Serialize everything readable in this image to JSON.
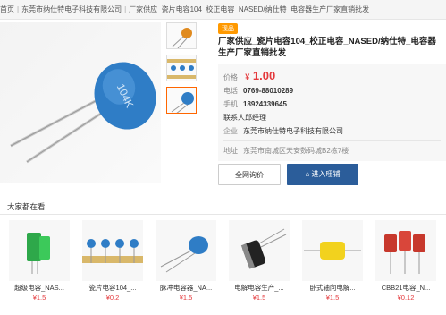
{
  "breadcrumb": {
    "home": "首页",
    "shop": "东莞市纳仕特电子科技有限公司",
    "product": "厂家供应_瓷片电容104_校正电容_NASED/纳仕特_电容器生产厂家直销批发"
  },
  "product": {
    "badge": "现品",
    "title": "厂家供应_瓷片电容104_校正电容_NASED/纳仕特_电容器生产厂家直销批发",
    "price_label": "价格",
    "price_currency": "¥",
    "price": "1.00",
    "phone_label": "电话",
    "phone": "0769-88010289",
    "mobile_label": "手机",
    "mobile": "18924339645",
    "contact_label": "联系人",
    "contact": "邱经理",
    "company_label": "企业",
    "company": "东莞市纳仕特电子科技有限公司",
    "address_label": "地址",
    "address": "东莞市南城区天安数码城B2栋7楼",
    "capacitor_marking": "104K"
  },
  "buttons": {
    "inquiry": "全网询价",
    "shop": "进入旺铺"
  },
  "section": {
    "title": "大家都在看"
  },
  "related": [
    {
      "name": "超级电容_NAS...",
      "price": "¥1.5"
    },
    {
      "name": "瓷片电容104_...",
      "price": "¥0.2"
    },
    {
      "name": "脉冲电容器_NA...",
      "price": "¥1.5"
    },
    {
      "name": "电解电容生产_...",
      "price": "¥1.5"
    },
    {
      "name": "卧式轴向电解...",
      "price": "¥1.5"
    },
    {
      "name": "CBB21电容_N...",
      "price": "¥0.12"
    }
  ]
}
